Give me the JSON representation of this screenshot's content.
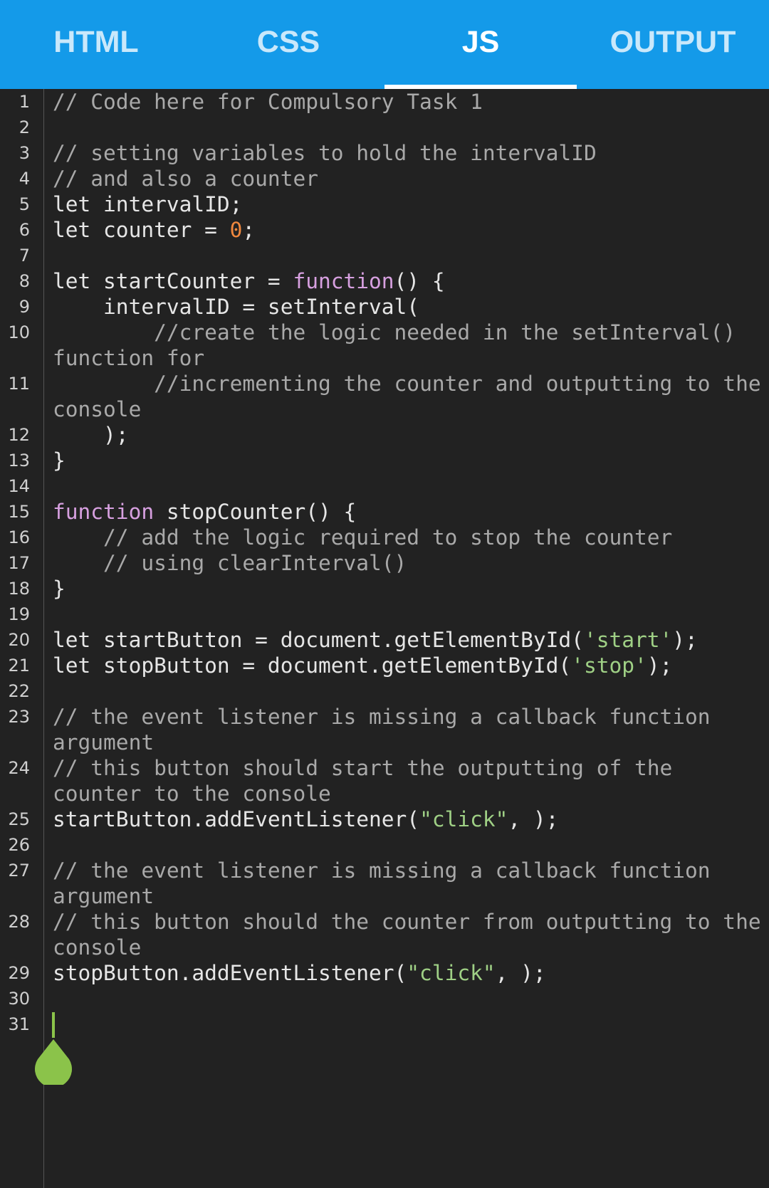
{
  "tabs": [
    {
      "label": "HTML",
      "active": false
    },
    {
      "label": "CSS",
      "active": false
    },
    {
      "label": "JS",
      "active": true
    },
    {
      "label": "OUTPUT",
      "active": false
    }
  ],
  "colors": {
    "tabbar": "#149ae9",
    "editor_bg": "#222222",
    "comment": "#a9a9a9",
    "keyword": "#d7a0e0",
    "number": "#f0883e",
    "string": "#9fd085",
    "cursor": "#8bc34a"
  },
  "editor": {
    "line_numbers": [
      "1",
      "2",
      "3",
      "4",
      "5",
      "6",
      "7",
      "8",
      "9",
      "10",
      "11",
      "12",
      "13",
      "14",
      "15",
      "16",
      "17",
      "18",
      "19",
      "20",
      "21",
      "22",
      "23",
      "24",
      "25",
      "26",
      "27",
      "28",
      "29",
      "30",
      "31"
    ],
    "lines": {
      "l1": "// Code here for Compulsory Task 1",
      "l3": "// setting variables to hold the intervalID",
      "l4": "// and also a counter",
      "l5": "let intervalID;",
      "l6a": "let counter = ",
      "l6b": "0",
      "l6c": ";",
      "l8a": "let startCounter = ",
      "l8b": "function",
      "l8c": "() {",
      "l9": "    intervalID = setInterval(",
      "l10": "        //create the logic needed in the setInterval() function for",
      "l11": "        //incrementing the counter and outputting to the console",
      "l12": "    );",
      "l13": "}",
      "l15a": "function",
      "l15b": " stopCounter() {",
      "l16": "    // add the logic required to stop the counter",
      "l17": "    // using clearInterval()",
      "l18": "}",
      "l20a": "let startButton = document.getElementById(",
      "l20b": "'start'",
      "l20c": ");",
      "l21a": "let stopButton = document.getElementById(",
      "l21b": "'stop'",
      "l21c": ");",
      "l23": "// the event listener is missing a callback function argument",
      "l24": "// this button should start the outputting of the counter to the console",
      "l25a": "startButton.addEventListener(",
      "l25b": "\"click\"",
      "l25c": ", );",
      "l27": "// the event listener is missing a callback function argument",
      "l28": "// this button should the counter from outputting to the console",
      "l29a": "stopButton.addEventListener(",
      "l29b": "\"click\"",
      "l29c": ", );"
    }
  }
}
